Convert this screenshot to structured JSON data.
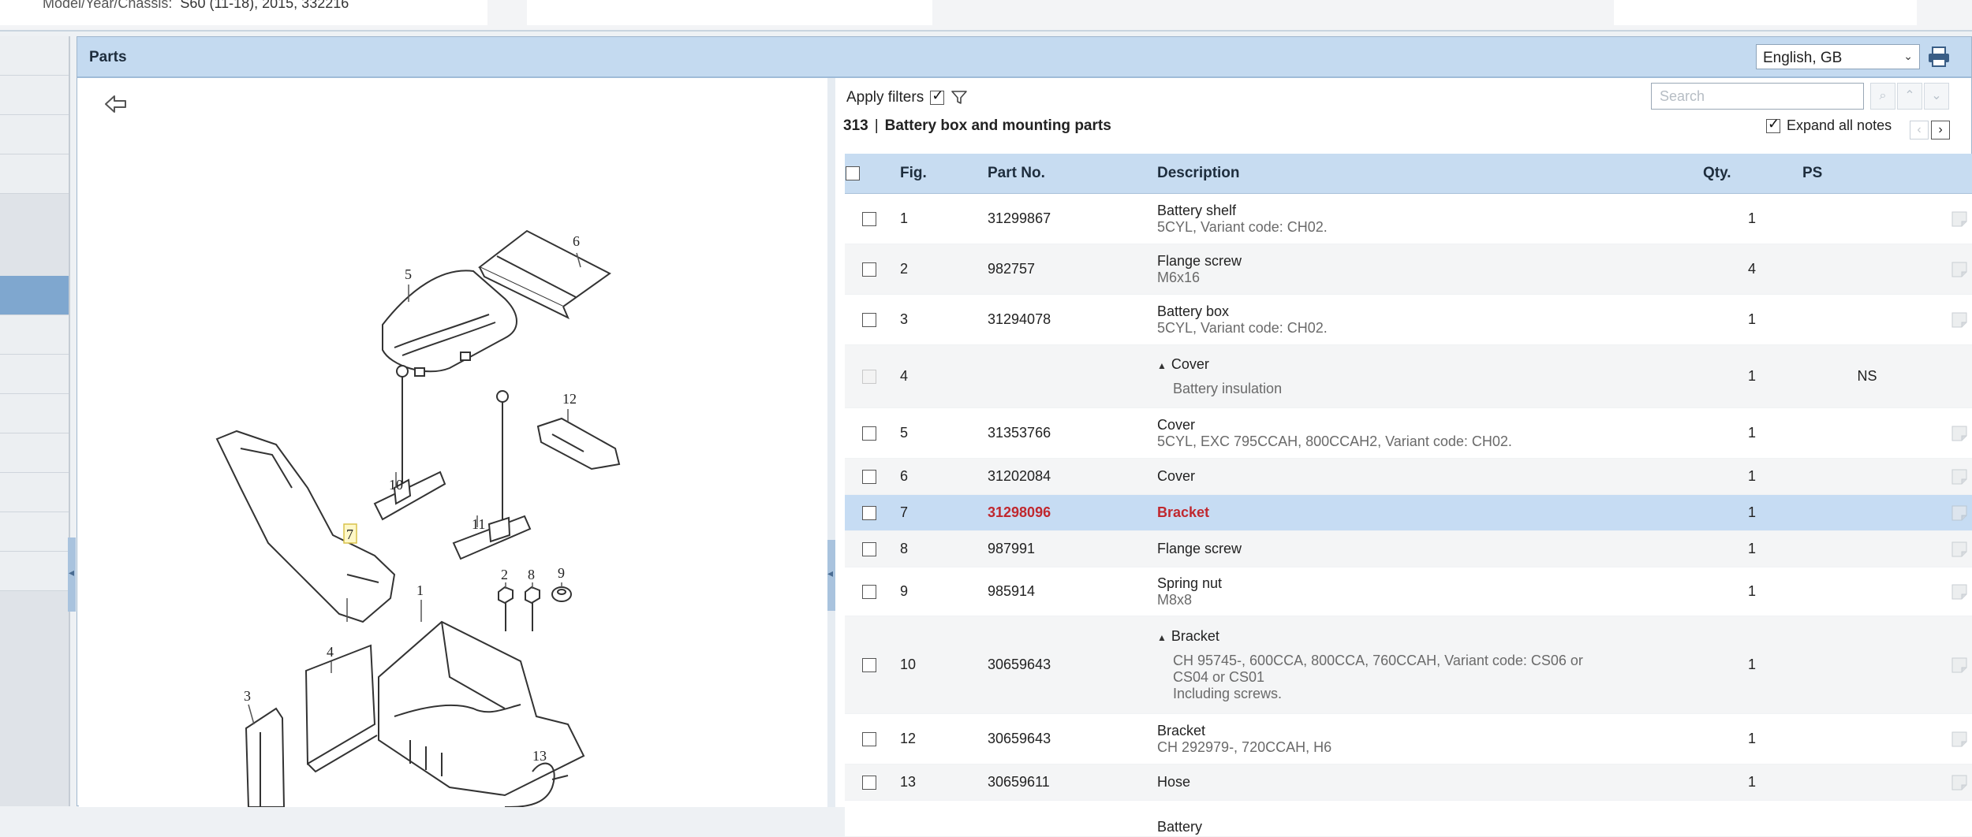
{
  "topbar": {
    "model_label": "Model/Year/Chassis:",
    "model_value": "S60 (11-18), 2015, 332216"
  },
  "panel": {
    "title": "Parts",
    "language": "English, GB"
  },
  "list": {
    "apply_filters": "Apply filters",
    "group_number": "313",
    "group_name": "Battery box and mounting parts",
    "search_placeholder": "Search",
    "expand_notes": "Expand all notes",
    "columns": {
      "fig": "Fig.",
      "part_no": "Part No.",
      "description": "Description",
      "qty": "Qty.",
      "ps": "PS"
    },
    "rows": [
      {
        "fig": "1",
        "part_no": "31299867",
        "desc": "Battery shelf",
        "sub": "5CYL, Variant code: CH02.",
        "qty": "1",
        "ps": ""
      },
      {
        "fig": "2",
        "part_no": "982757",
        "desc": "Flange screw",
        "sub": "M6x16",
        "qty": "4",
        "ps": ""
      },
      {
        "fig": "3",
        "part_no": "31294078",
        "desc": "Battery box",
        "sub": "5CYL, Variant code: CH02.",
        "qty": "1",
        "ps": ""
      },
      {
        "fig": "4",
        "part_no": "",
        "desc": "Cover",
        "note": "Battery insulation",
        "qty": "1",
        "ps": "NS"
      },
      {
        "fig": "5",
        "part_no": "31353766",
        "desc": "Cover",
        "sub": "5CYL, EXC 795CCAH, 800CCAH2, Variant code: CH02.",
        "qty": "1",
        "ps": ""
      },
      {
        "fig": "6",
        "part_no": "31202084",
        "desc": "Cover",
        "qty": "1",
        "ps": ""
      },
      {
        "fig": "7",
        "part_no": "31298096",
        "desc": "Bracket",
        "qty": "1",
        "ps": ""
      },
      {
        "fig": "8",
        "part_no": "987991",
        "desc": "Flange screw",
        "qty": "1",
        "ps": ""
      },
      {
        "fig": "9",
        "part_no": "985914",
        "desc": "Spring nut",
        "sub": "M8x8",
        "qty": "1",
        "ps": ""
      },
      {
        "fig": "10",
        "part_no": "30659643",
        "desc": "Bracket",
        "note": "CH 95745-, 600CCA, 800CCA, 760CCAH, Variant code: CS06 or",
        "note2": "CS04 or CS01",
        "note3": "Including screws.",
        "qty": "1",
        "ps": ""
      },
      {
        "fig": "12",
        "part_no": "30659643",
        "desc": "Bracket",
        "sub": "CH 292979-, 720CCAH, H6",
        "qty": "1",
        "ps": ""
      },
      {
        "fig": "13",
        "part_no": "30659611",
        "desc": "Hose",
        "qty": "1",
        "ps": ""
      },
      {
        "fig": "",
        "part_no": "",
        "desc": "Battery",
        "qty": "",
        "ps": ""
      }
    ]
  },
  "diagram": {
    "callouts": [
      "6",
      "5",
      "12",
      "10",
      "11",
      "7",
      "1",
      "2",
      "8",
      "9",
      "4",
      "3",
      "13"
    ]
  }
}
